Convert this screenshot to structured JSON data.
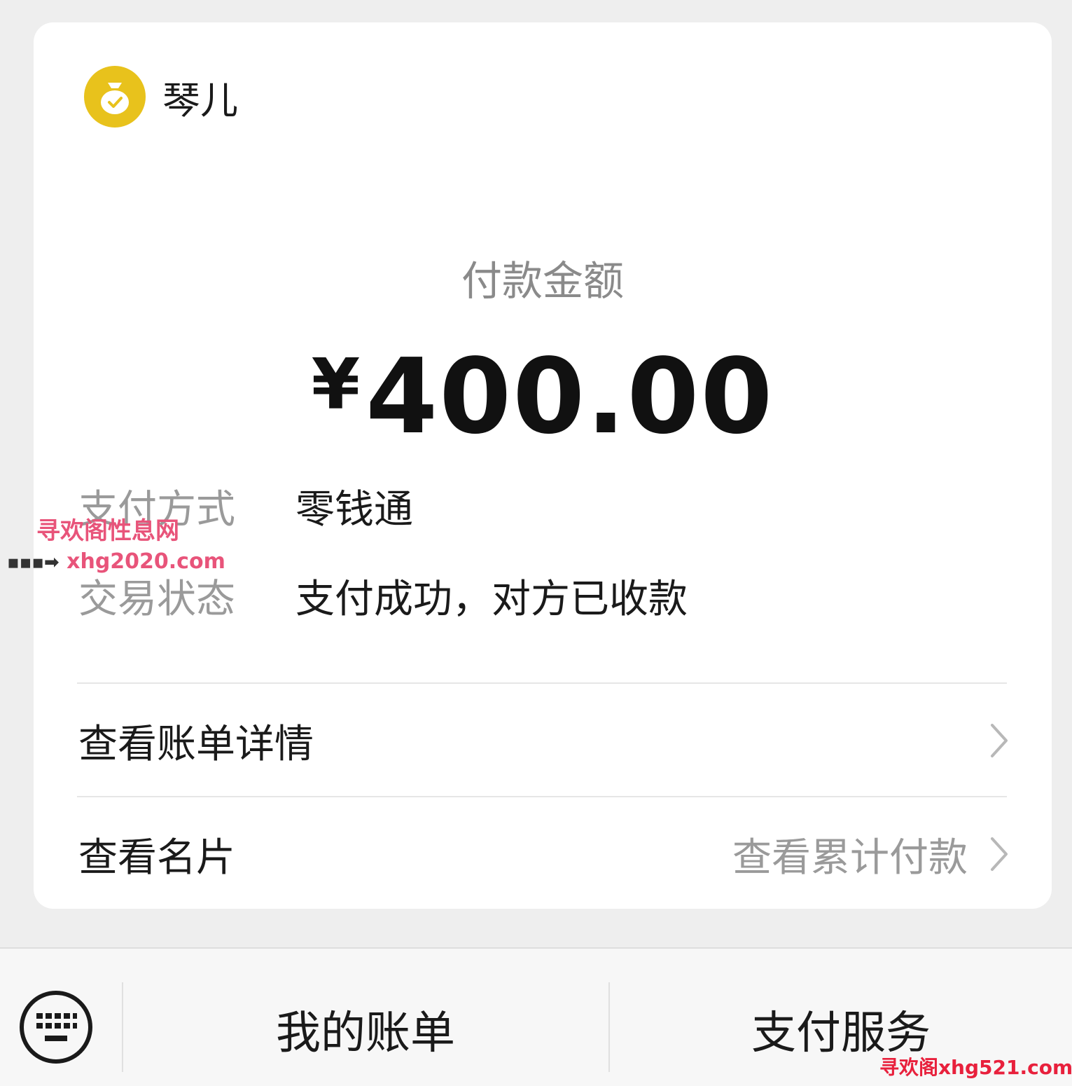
{
  "merchant": {
    "name": "琴儿",
    "icon": "money-bag-icon"
  },
  "payment": {
    "amount_label": "付款金额",
    "currency": "¥",
    "amount": "400.00",
    "method_key": "支付方式",
    "method_value": "零钱通",
    "status_key": "交易状态",
    "status_value": "支付成功，对方已收款"
  },
  "links": {
    "bill_details": "查看账单详情",
    "business_card": "查看名片",
    "cumulative_payment": "查看累计付款"
  },
  "bottom_bar": {
    "tab_bills": "我的账单",
    "tab_services": "支付服务"
  },
  "watermarks": {
    "site_name": "寻欢阁性息网",
    "site_url": "xhg2020.com",
    "corner": "寻欢阁xhg521.com"
  },
  "colors": {
    "logo_yellow": "#e8c21c",
    "watermark_pink": "#e8547a"
  }
}
